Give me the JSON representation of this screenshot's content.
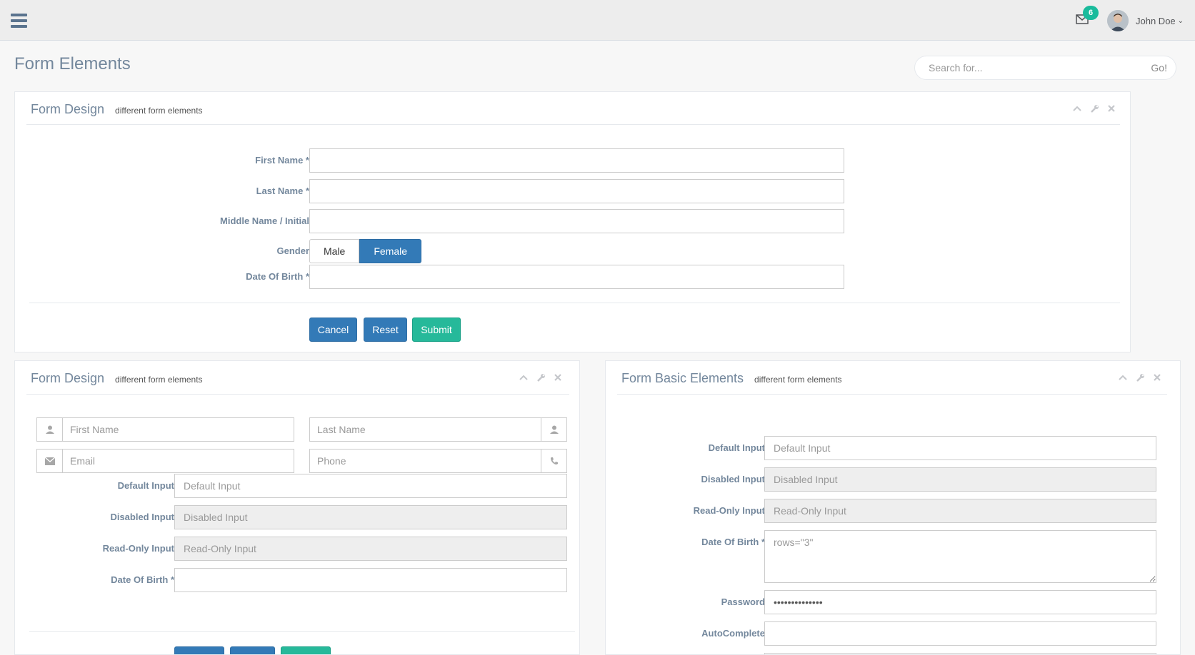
{
  "header": {
    "notifications_count": "6",
    "user_name": "John Doe"
  },
  "page": {
    "title": "Form Elements"
  },
  "search": {
    "placeholder": "Search for...",
    "go_label": "Go!"
  },
  "panel1": {
    "title": "Form Design",
    "subtitle": "different form elements",
    "fields": {
      "first_name": "First Name *",
      "last_name": "Last Name *",
      "middle_name": "Middle Name / Initial",
      "gender": "Gender",
      "dob": "Date Of Birth *"
    },
    "gender_options": {
      "male": "Male",
      "female": "Female",
      "selected": "Female"
    },
    "buttons": {
      "cancel": "Cancel",
      "reset": "Reset",
      "submit": "Submit"
    }
  },
  "panel2": {
    "title": "Form Design",
    "subtitle": "different form elements",
    "placeholders": {
      "first_name": "First Name",
      "last_name": "Last Name",
      "email": "Email",
      "phone": "Phone",
      "default": "Default Input",
      "disabled": "Disabled Input",
      "readonly": "Read-Only Input"
    },
    "labels": {
      "default": "Default Input",
      "disabled": "Disabled Input",
      "readonly": "Read-Only Input",
      "dob": "Date Of Birth *"
    }
  },
  "panel3": {
    "title": "Form Basic Elements",
    "subtitle": "different form elements",
    "labels": {
      "default": "Default Input",
      "disabled": "Disabled Input",
      "readonly": "Read-Only Input",
      "dob": "Date Of Birth *",
      "password": "Password",
      "autocomplete": "AutoComplete"
    },
    "placeholders": {
      "default": "Default Input",
      "disabled": "Disabled Input",
      "readonly": "Read-Only Input",
      "textarea": "rows=\"3\""
    },
    "password_value": "passwordonetwo"
  }
}
